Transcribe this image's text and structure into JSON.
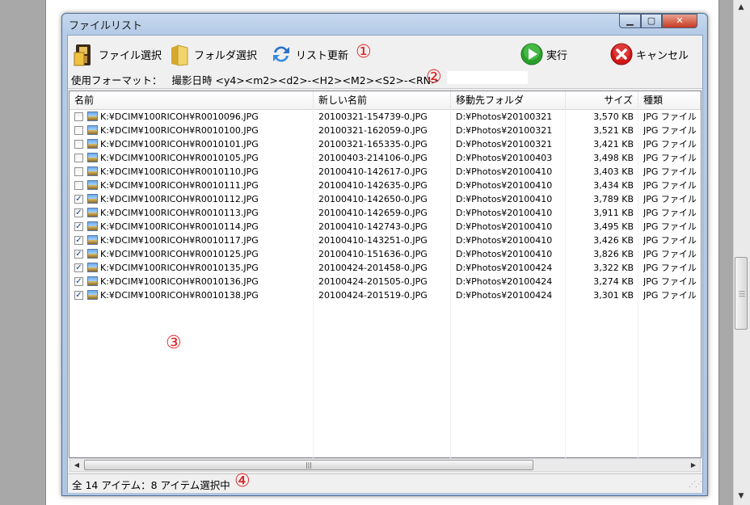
{
  "window": {
    "title": "ファイルリスト"
  },
  "toolbar": {
    "file_select": "ファイル選択",
    "folder_select": "フォルダ選択",
    "refresh": "リスト更新",
    "run": "実行",
    "cancel": "キャンセル"
  },
  "format": {
    "label": "使用フォーマット：",
    "value": "撮影日時 <y4><m2><d2>-<H2><M2><S2>-<RN>"
  },
  "callouts": [
    "①",
    "②",
    "③",
    "④"
  ],
  "list": {
    "columns": [
      "名前",
      "新しい名前",
      "移動先フォルダ",
      "サイズ",
      "種類"
    ],
    "rows": [
      {
        "checked": false,
        "name": "K:¥DCIM¥100RICOH¥R0010096.JPG",
        "new_name": "20100321-154739-0.JPG",
        "dest": "D:¥Photos¥20100321",
        "size": "3,570 KB",
        "type": "JPG ファイル"
      },
      {
        "checked": false,
        "name": "K:¥DCIM¥100RICOH¥R0010100.JPG",
        "new_name": "20100321-162059-0.JPG",
        "dest": "D:¥Photos¥20100321",
        "size": "3,521 KB",
        "type": "JPG ファイル"
      },
      {
        "checked": false,
        "name": "K:¥DCIM¥100RICOH¥R0010101.JPG",
        "new_name": "20100321-165335-0.JPG",
        "dest": "D:¥Photos¥20100321",
        "size": "3,421 KB",
        "type": "JPG ファイル"
      },
      {
        "checked": false,
        "name": "K:¥DCIM¥100RICOH¥R0010105.JPG",
        "new_name": "20100403-214106-0.JPG",
        "dest": "D:¥Photos¥20100403",
        "size": "3,498 KB",
        "type": "JPG ファイル"
      },
      {
        "checked": false,
        "name": "K:¥DCIM¥100RICOH¥R0010110.JPG",
        "new_name": "20100410-142617-0.JPG",
        "dest": "D:¥Photos¥20100410",
        "size": "3,403 KB",
        "type": "JPG ファイル"
      },
      {
        "checked": false,
        "name": "K:¥DCIM¥100RICOH¥R0010111.JPG",
        "new_name": "20100410-142635-0.JPG",
        "dest": "D:¥Photos¥20100410",
        "size": "3,434 KB",
        "type": "JPG ファイル"
      },
      {
        "checked": true,
        "name": "K:¥DCIM¥100RICOH¥R0010112.JPG",
        "new_name": "20100410-142650-0.JPG",
        "dest": "D:¥Photos¥20100410",
        "size": "3,789 KB",
        "type": "JPG ファイル"
      },
      {
        "checked": true,
        "name": "K:¥DCIM¥100RICOH¥R0010113.JPG",
        "new_name": "20100410-142659-0.JPG",
        "dest": "D:¥Photos¥20100410",
        "size": "3,911 KB",
        "type": "JPG ファイル"
      },
      {
        "checked": true,
        "name": "K:¥DCIM¥100RICOH¥R0010114.JPG",
        "new_name": "20100410-142743-0.JPG",
        "dest": "D:¥Photos¥20100410",
        "size": "3,495 KB",
        "type": "JPG ファイル"
      },
      {
        "checked": true,
        "name": "K:¥DCIM¥100RICOH¥R0010117.JPG",
        "new_name": "20100410-143251-0.JPG",
        "dest": "D:¥Photos¥20100410",
        "size": "3,426 KB",
        "type": "JPG ファイル"
      },
      {
        "checked": true,
        "name": "K:¥DCIM¥100RICOH¥R0010125.JPG",
        "new_name": "20100410-151636-0.JPG",
        "dest": "D:¥Photos¥20100410",
        "size": "3,826 KB",
        "type": "JPG ファイル"
      },
      {
        "checked": true,
        "name": "K:¥DCIM¥100RICOH¥R0010135.JPG",
        "new_name": "20100424-201458-0.JPG",
        "dest": "D:¥Photos¥20100424",
        "size": "3,322 KB",
        "type": "JPG ファイル"
      },
      {
        "checked": true,
        "name": "K:¥DCIM¥100RICOH¥R0010136.JPG",
        "new_name": "20100424-201505-0.JPG",
        "dest": "D:¥Photos¥20100424",
        "size": "3,274 KB",
        "type": "JPG ファイル"
      },
      {
        "checked": true,
        "name": "K:¥DCIM¥100RICOH¥R0010138.JPG",
        "new_name": "20100424-201519-0.JPG",
        "dest": "D:¥Photos¥20100424",
        "size": "3,301 KB",
        "type": "JPG ファイル"
      }
    ]
  },
  "status": {
    "text": "全 14 アイテム：8 アイテム選択中"
  },
  "icons": {
    "file_select": "film-file-icon",
    "folder_select": "folder-icon",
    "refresh": "refresh-icon",
    "run": "play-icon",
    "cancel": "cancel-icon",
    "row_file": "image-file-icon"
  },
  "colors": {
    "callout": "#e02020",
    "run": "#2aa02a",
    "cancel": "#d01818"
  }
}
